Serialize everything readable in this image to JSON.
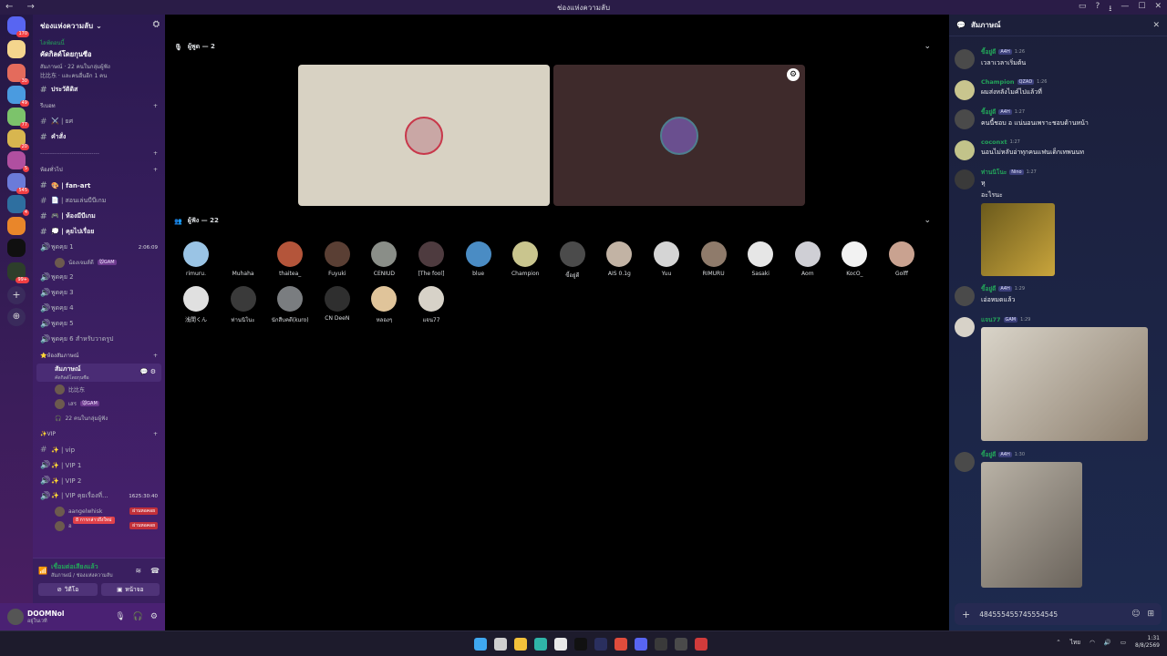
{
  "window": {
    "title": "ช่องแห่งความลับ",
    "nav_icons": "← →",
    "controls": [
      "▭",
      "?",
      "⭳",
      "—",
      "☐",
      "✕"
    ]
  },
  "guilds": {
    "items": [
      {
        "name": "discord-home-icon",
        "color": "#5865f2",
        "badge": "170"
      },
      {
        "name": "server-1-icon",
        "color": "#f4d58d",
        "badge": ""
      },
      {
        "name": "server-2-icon",
        "color": "#e46b5c",
        "badge": "30"
      },
      {
        "name": "server-3-icon",
        "color": "#4a9be0",
        "badge": "49"
      },
      {
        "name": "server-4-icon",
        "color": "#7cc36b",
        "badge": "77"
      },
      {
        "name": "server-5-icon",
        "color": "#d8b64f",
        "badge": "20"
      },
      {
        "name": "server-6-icon",
        "color": "#b04fa0",
        "badge": "5"
      },
      {
        "name": "server-7-icon",
        "color": "#6b7bd9",
        "badge": "545"
      },
      {
        "name": "server-8-icon",
        "color": "#2e6fa0",
        "badge": "4"
      },
      {
        "name": "server-9-icon",
        "color": "#e9862a",
        "badge": ""
      },
      {
        "name": "server-nana-icon",
        "color": "#101010",
        "badge": ""
      },
      {
        "name": "server-11-icon",
        "color": "#2d3e2b",
        "badge": "99+"
      }
    ]
  },
  "sidebar": {
    "server_name": "ช่องแห่งความลับ",
    "event": {
      "live": "ไลฟ์ตอนนี้",
      "title": "คัดกิลด์โดยกุนซือ",
      "line1": "สัมภาษณ์ · 22 คนในกลุ่มผู้ฟัง",
      "line2": "比比东 · และคนอื่นอีก 1 คน"
    },
    "pinned": [
      {
        "label": "ประวัติดิส"
      }
    ],
    "cat_welcome": "รีเบอท",
    "welcome_channels": [
      {
        "label": "⚔️ | ยศ"
      },
      {
        "label": "คำสั่ง"
      }
    ],
    "cat_dashes": "------------------------------",
    "cat_general": "ห้องทั่วไป",
    "general_channels": [
      {
        "label": "🎨 | fan-art"
      },
      {
        "label": "📄 | สอนเล่นบีบีเกม"
      },
      {
        "label": "🎮 | ห้องมีบีเกม"
      },
      {
        "label": "💭 | คุยไปเรื่อย"
      }
    ],
    "voice_talk1": {
      "label": "พูดคุย 1",
      "time": "2:06:09",
      "user": "น้องเจมส์ดี",
      "user_tag": "🐭GAM"
    },
    "voice_list": [
      "พูดคุย 2",
      "พูดคุย 3",
      "พูดคุย 4",
      "พูดคุย 5",
      "พูดคุย 6 สำหรับวาดรูป"
    ],
    "cat_stage": "⭐ห้องสัมภาษณ์",
    "stage_channel": {
      "label": "สัมภาษณ์",
      "sub": "คัดกิลด์โดยกุนซือ"
    },
    "stage_users": [
      {
        "name": "比比东",
        "tag": ""
      },
      {
        "name": "เสร",
        "tag": "🐭GAM"
      }
    ],
    "stage_audience": "22 คนในกลุ่มผู้ฟัง",
    "cat_vip": "✨VIP",
    "vip_channels": [
      {
        "label": "✨ | vip"
      },
      {
        "label": "✨ | VIP 1"
      },
      {
        "label": "✨ | VIP 2"
      }
    ],
    "vip_talk": {
      "label": "✨ | VIP คุยเรื่องที่...",
      "time": "1625:30:40"
    },
    "vip_users": [
      {
        "name": "aangelwhisk",
        "tag": "ผ่านหอคอย"
      },
      {
        "name": "อ",
        "tag": "ผ่านหอคอย",
        "popup": "8 การกล่าวถึงใหม่"
      }
    ]
  },
  "voice_panel": {
    "status": "เชื่อมต่อเสียงแล้ว",
    "sub": "สัมภาษณ์ / ช่องแห่งความลับ",
    "video": "วิดีโอ",
    "screen": "หน้าจอ"
  },
  "user_panel": {
    "name": "DOOMNol",
    "status": "อยู่ในเวที"
  },
  "stage": {
    "speakers_label": "ผู้พูด — 2",
    "audience_label": "ผู้ฟัง — 22",
    "speaker_tiles": [
      {
        "bg": "#d8d2c3",
        "av": "#c9a7a5"
      },
      {
        "bg": "#3e2a2b",
        "av": "#6a4f8f"
      }
    ],
    "audience": [
      {
        "name": "rimuru.",
        "color": "#9ac4e5"
      },
      {
        "name": "Muhaha",
        "color": "#000000"
      },
      {
        "name": "thaitea_",
        "color": "#b4553a"
      },
      {
        "name": "Fuyuki",
        "color": "#5a3f34"
      },
      {
        "name": "CENIUD",
        "color": "#8a8e88"
      },
      {
        "name": "[The fool]",
        "color": "#4e3b3f"
      },
      {
        "name": "blue",
        "color": "#4a8cc4"
      },
      {
        "name": "Champion",
        "color": "#c9c58e"
      },
      {
        "name": "ขี้อยู่ดี",
        "color": "#4b4b4b"
      },
      {
        "name": "AIS 0.1g",
        "color": "#c2b3a4"
      },
      {
        "name": "Yuu",
        "color": "#d5d5d5"
      },
      {
        "name": "RIMURU",
        "color": "#8f7b6b"
      },
      {
        "name": "Sasaki",
        "color": "#e6e6e6"
      },
      {
        "name": "Aom",
        "color": "#cfcfd5"
      },
      {
        "name": "KocO_",
        "color": "#f2f2f2"
      },
      {
        "name": "Golff",
        "color": "#c9a290"
      },
      {
        "name": "浅間くん",
        "color": "#e0e0e0"
      },
      {
        "name": "ท่านนิโนะ",
        "color": "#3a3a3a"
      },
      {
        "name": "นักสืบคดี(kuro)",
        "color": "#7a7d80"
      },
      {
        "name": "CN DeeN",
        "color": "#2f2f2f"
      },
      {
        "name": "หลองๆ",
        "color": "#e0c49a"
      },
      {
        "name": "แจน77",
        "color": "#d7d2c8"
      }
    ]
  },
  "chat": {
    "title": "สัมภาษณ์",
    "messages": [
      {
        "name": "ขี้อยู่ดี",
        "tag": "A4H",
        "time": "1:26",
        "text": "เวลาเวลาเริ่มต้น",
        "color": "#23a55a",
        "av": "#4a4a4a"
      },
      {
        "name": "Champion",
        "tag": "QZAD",
        "time": "1:26",
        "text": "ผมส่งหลังไมค์ไปแล้วที่",
        "color": "#23a55a",
        "av": "#c9c58e"
      },
      {
        "name": "ขี้อยู่ดี",
        "tag": "A4H",
        "time": "1:27",
        "text": "คนนี้ชอบ อ แน่นอนเพราะชอบด้านหน้า",
        "color": "#23a55a",
        "av": "#4a4a4a"
      },
      {
        "name": "coconxt",
        "tag": "",
        "time": "1:27",
        "text": "นอนไม่หลับอ่าทุกคนแฟนเด็กเทพนนท",
        "color": "#23a55a",
        "av": "#c2c38a"
      },
      {
        "name": "ท่านนิโนะ",
        "tag": "Nino",
        "time": "1:27",
        "text": "หุ",
        "text2": "อะไรนะ",
        "color": "#23a55a",
        "av": "#3a3a3a"
      },
      {
        "name": "ขี้อยู่ดี",
        "tag": "A4H",
        "time": "1:29",
        "text": "เอ่อหมดแล้ว",
        "color": "#23a55a",
        "av": "#4a4a4a"
      },
      {
        "name": "แจน77",
        "tag": "GAM",
        "time": "1:29",
        "text": "",
        "color": "#23a55a",
        "av": "#d7d2c8"
      },
      {
        "name": "ขี้อยู่ดี",
        "tag": "A4H",
        "time": "1:30",
        "text": "",
        "color": "#23a55a",
        "av": "#4a4a4a"
      }
    ],
    "input_value": "484555455745554545"
  },
  "taskbar": {
    "icons": [
      {
        "name": "windows-start-icon",
        "color": "#3fa8f0"
      },
      {
        "name": "search-icon",
        "color": "#cfcfcf"
      },
      {
        "name": "file-explorer-icon",
        "color": "#f3c13a"
      },
      {
        "name": "edge-icon",
        "color": "#2fb5a8"
      },
      {
        "name": "store-icon",
        "color": "#e9e9e9"
      },
      {
        "name": "tiktok-icon",
        "color": "#111111"
      },
      {
        "name": "photoshop-icon",
        "color": "#2a2f5e"
      },
      {
        "name": "chrome-icon",
        "color": "#e04c3c"
      },
      {
        "name": "discord-icon",
        "color": "#5865f2"
      },
      {
        "name": "terminal-icon",
        "color": "#3a3a3a"
      },
      {
        "name": "app-icon",
        "color": "#4a4a4a"
      },
      {
        "name": "recorder-icon",
        "color": "#d03b3b"
      }
    ],
    "lang": "ไทย",
    "time": "1:31",
    "date": "8/8/2569"
  }
}
